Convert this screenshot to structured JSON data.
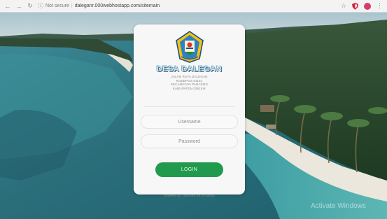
{
  "browser": {
    "back_icon": "arrow-left-icon",
    "forward_icon": "arrow-right-icon",
    "reload_icon": "reload-icon",
    "secure_label": "Not secure",
    "url": "daleganr.000webhostapp.com/sitemain",
    "bookmark_icon": "star-icon",
    "shield_icon": "shield-icon",
    "menu_icon": "menu-dots-icon"
  },
  "login": {
    "org_title": "DESA DALEGAN",
    "address_lines": [
      "JALAN RAYA DALEGAN",
      "KODEPOS 61151",
      "KECAMATAN PANCENG",
      "KABUPATEN GRESIK"
    ],
    "username_placeholder": "Username",
    "password_placeholder": "Password",
    "login_label": "LOGIN",
    "powered_by": "powered by: OpenSID 19.10-pantai"
  },
  "watermark": "Activate Windows",
  "colors": {
    "accent_green": "#229a4d",
    "card_bg": "#f7f7f7"
  }
}
